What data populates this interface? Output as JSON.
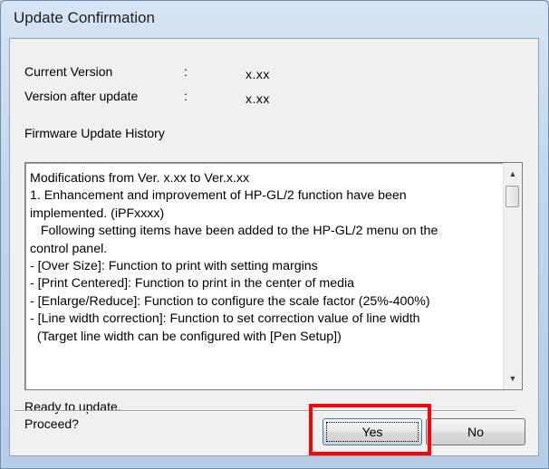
{
  "window": {
    "title": "Update Confirmation"
  },
  "versions": {
    "current_label": "Current Version",
    "current_value": "x.xx",
    "after_label": "Version after update",
    "after_value": "x.xx",
    "separator": ":"
  },
  "history": {
    "heading": "Firmware Update History",
    "lines": [
      "Modifications from Ver. x.xx to Ver.x.xx",
      "1. Enhancement and improvement of HP-GL/2 function have been",
      "implemented. (iPFxxxx)",
      "   Following setting items have been added to the HP-GL/2 menu on the",
      "control panel.",
      "- [Over Size]: Function to print with setting margins",
      "- [Print Centered]: Function to print in the center of media",
      "- [Enlarge/Reduce]: Function to configure the scale factor (25%-400%)",
      "- [Line width correction]: Function to set correction value of line width",
      "  (Target line width can be configured with [Pen Setup])"
    ]
  },
  "prompt": {
    "line1": "Ready to update.",
    "line2": "Proceed?"
  },
  "buttons": {
    "yes": "Yes",
    "no": "No"
  },
  "icons": {
    "scroll_up": "scroll-up-arrow-icon",
    "scroll_down": "scroll-down-arrow-icon"
  },
  "colors": {
    "highlight": "#ff0000"
  }
}
